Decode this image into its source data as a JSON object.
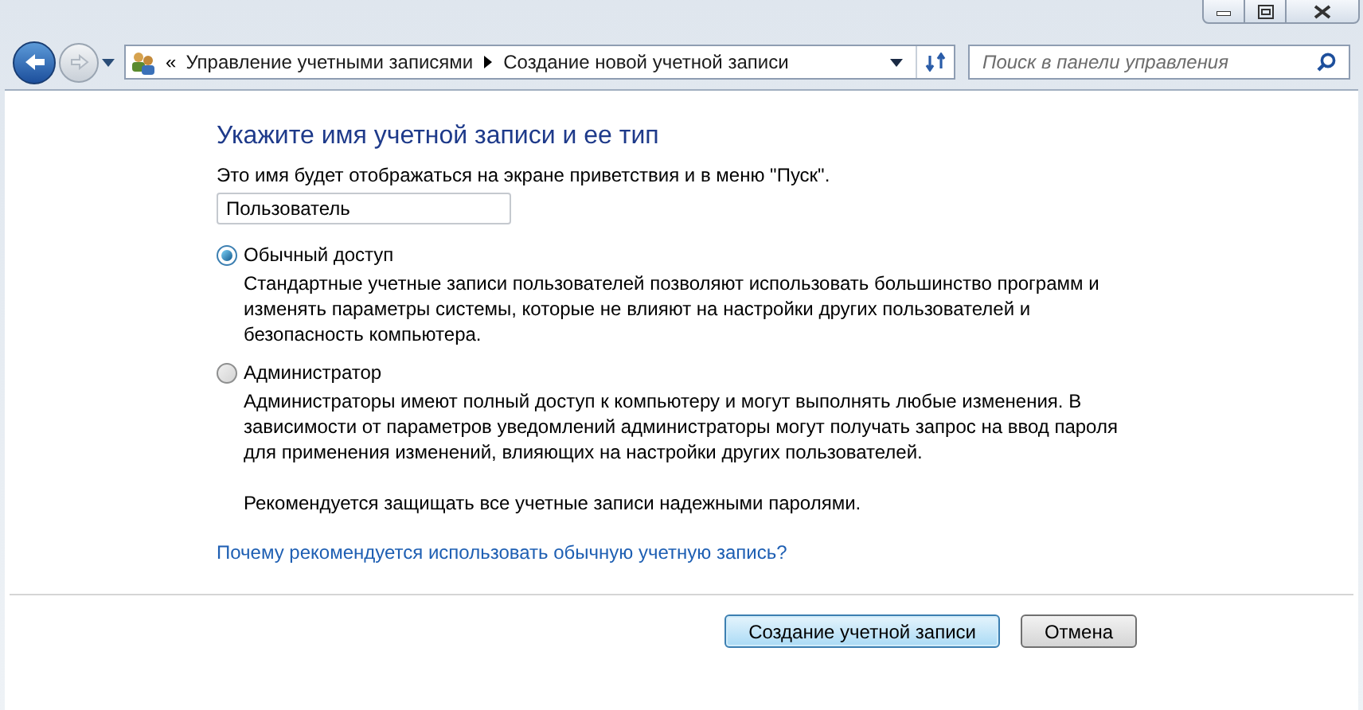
{
  "breadcrumb": {
    "overflow": "«",
    "items": [
      "Управление учетными записями",
      "Создание новой учетной записи"
    ]
  },
  "search": {
    "placeholder": "Поиск в панели управления"
  },
  "heading": "Укажите имя учетной записи и ее тип",
  "name_prompt": "Это имя будет отображаться на экране приветствия и в меню \"Пуск\".",
  "name_field": {
    "value": "Пользователь"
  },
  "account_types": [
    {
      "label": "Обычный доступ",
      "selected": true,
      "description": "Стандартные учетные записи пользователей позволяют использовать большинство программ и изменять параметры системы, которые не влияют на настройки других пользователей и безопасность компьютера."
    },
    {
      "label": "Администратор",
      "selected": false,
      "description": "Администраторы имеют полный доступ к компьютеру и могут выполнять любые изменения. В зависимости от параметров уведомлений администраторы могут получать запрос на ввод пароля для применения изменений, влияющих на настройки других пользователей."
    }
  ],
  "recommendation": "Рекомендуется защищать все учетные записи надежными паролями.",
  "help_link": "Почему рекомендуется использовать обычную учетную запись?",
  "buttons": [
    {
      "label": "Создание учетной записи",
      "kind": "default"
    },
    {
      "label": "Отмена",
      "kind": "normal"
    }
  ]
}
